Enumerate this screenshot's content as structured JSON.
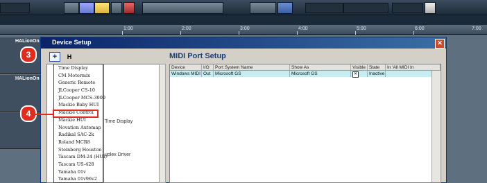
{
  "timeline": {
    "markers": [
      "1:00",
      "2:00",
      "3:00",
      "4:00",
      "5:00",
      "6:00",
      "7:00"
    ]
  },
  "tracks": [
    {
      "name": "HALionOn"
    },
    {
      "name": "HALionOn"
    },
    {
      "name": ""
    }
  ],
  "dialog": {
    "title": "Device Setup",
    "close_glyph": "✕",
    "add_button_glyph": "+",
    "remove_button_glyph": "H",
    "device_menu": [
      "Time Display",
      "CM Motormix",
      "Generic Remote",
      "JLCooper CS-10",
      "JLCooper MCS-3000",
      "Mackie Baby HUI",
      "Mackie Control",
      "Mackie HUI",
      "Novation Automap",
      "Radikal SAC-2k",
      "Roland MCR8",
      "Steinberg Houston",
      "Tascam DM-24 (HUI)",
      "Tascam US-428",
      "Yamaha 01v",
      "Yamaha 01v96v2"
    ],
    "left_labels": [
      "Time Display",
      "uplex Driver"
    ],
    "section_title": "MIDI Port Setup",
    "table": {
      "columns": [
        "Device",
        "I/O",
        "Port System Name",
        "Show As",
        "Visible",
        "State",
        "In 'All MIDI In"
      ],
      "rows": [
        {
          "device": "Windows MIDI",
          "io": "Out",
          "port": "Microsoft GS",
          "show_as": "Microsoft GS",
          "visible": "✕",
          "state": "Inactive"
        }
      ]
    }
  },
  "annotations": {
    "step3": "3",
    "step4": "4"
  },
  "colors": {
    "accent": "#e02b1f",
    "title_bar": "#0a246a",
    "row_highlight": "#c7ecf2"
  }
}
